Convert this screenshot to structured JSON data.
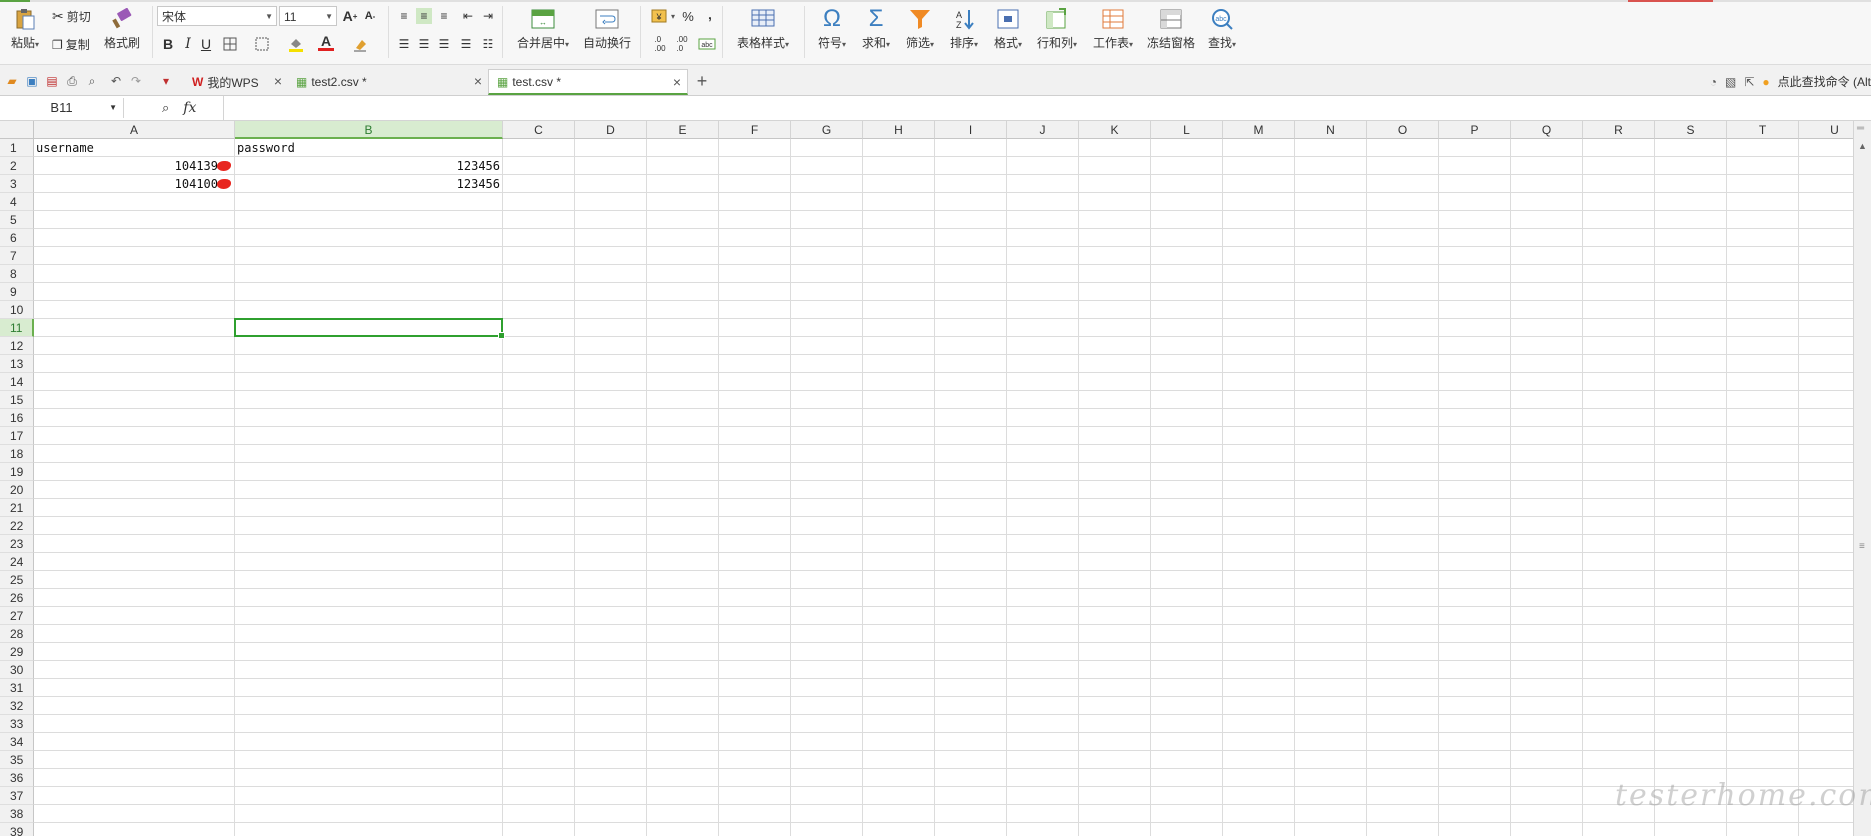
{
  "ribbon": {
    "paste_label": "粘贴",
    "cut_label": "剪切",
    "copy_label": "复制",
    "format_painter_label": "格式刷",
    "font_name": "宋体",
    "font_size": "11",
    "merge_center_label": "合并居中",
    "wrap_text_label": "自动换行",
    "percent_symbol": "%",
    "comma_symbol": "‚",
    "table_style_label": "表格样式",
    "symbol_label": "符号",
    "sum_label": "求和",
    "filter_label": "筛选",
    "sort_label": "排序",
    "format_label": "格式",
    "rows_cols_label": "行和列",
    "worksheet_label": "工作表",
    "freeze_label": "冻结窗格",
    "find_label": "查找"
  },
  "tabs": [
    {
      "label": "我的WPS",
      "active": false
    },
    {
      "label": "test2.csv *",
      "active": false
    },
    {
      "label": "test.csv *",
      "active": true
    }
  ],
  "search_command": "点此查找命令 (Alt",
  "formula_bar": {
    "cell_ref": "B11",
    "fx_label": "fx",
    "content": ""
  },
  "sheet": {
    "columns": [
      "A",
      "B",
      "C",
      "D",
      "E",
      "F",
      "G",
      "H",
      "I",
      "J",
      "K",
      "L",
      "M",
      "N",
      "O",
      "P",
      "Q",
      "R",
      "S",
      "T",
      "U"
    ],
    "rows": [
      "1",
      "2",
      "3",
      "4",
      "5",
      "6",
      "7",
      "8",
      "9",
      "10",
      "11",
      "12",
      "13",
      "14",
      "15",
      "16",
      "17",
      "18",
      "19",
      "20",
      "21",
      "22",
      "23",
      "24",
      "25",
      "26",
      "27",
      "28",
      "29",
      "30",
      "31",
      "32",
      "33",
      "34",
      "35",
      "36",
      "37",
      "38",
      "39"
    ],
    "selected_col": "B",
    "selected_row": "11",
    "cells": {
      "A1": "username",
      "B1": "password",
      "A2": "104139",
      "B2": "123456",
      "A3": "104100",
      "B3": "123456"
    }
  },
  "watermark": "testerhome.com",
  "colors": {
    "accent_green": "#5aa342",
    "selection_green": "#2fa02f",
    "redact_red": "#e8261f"
  }
}
